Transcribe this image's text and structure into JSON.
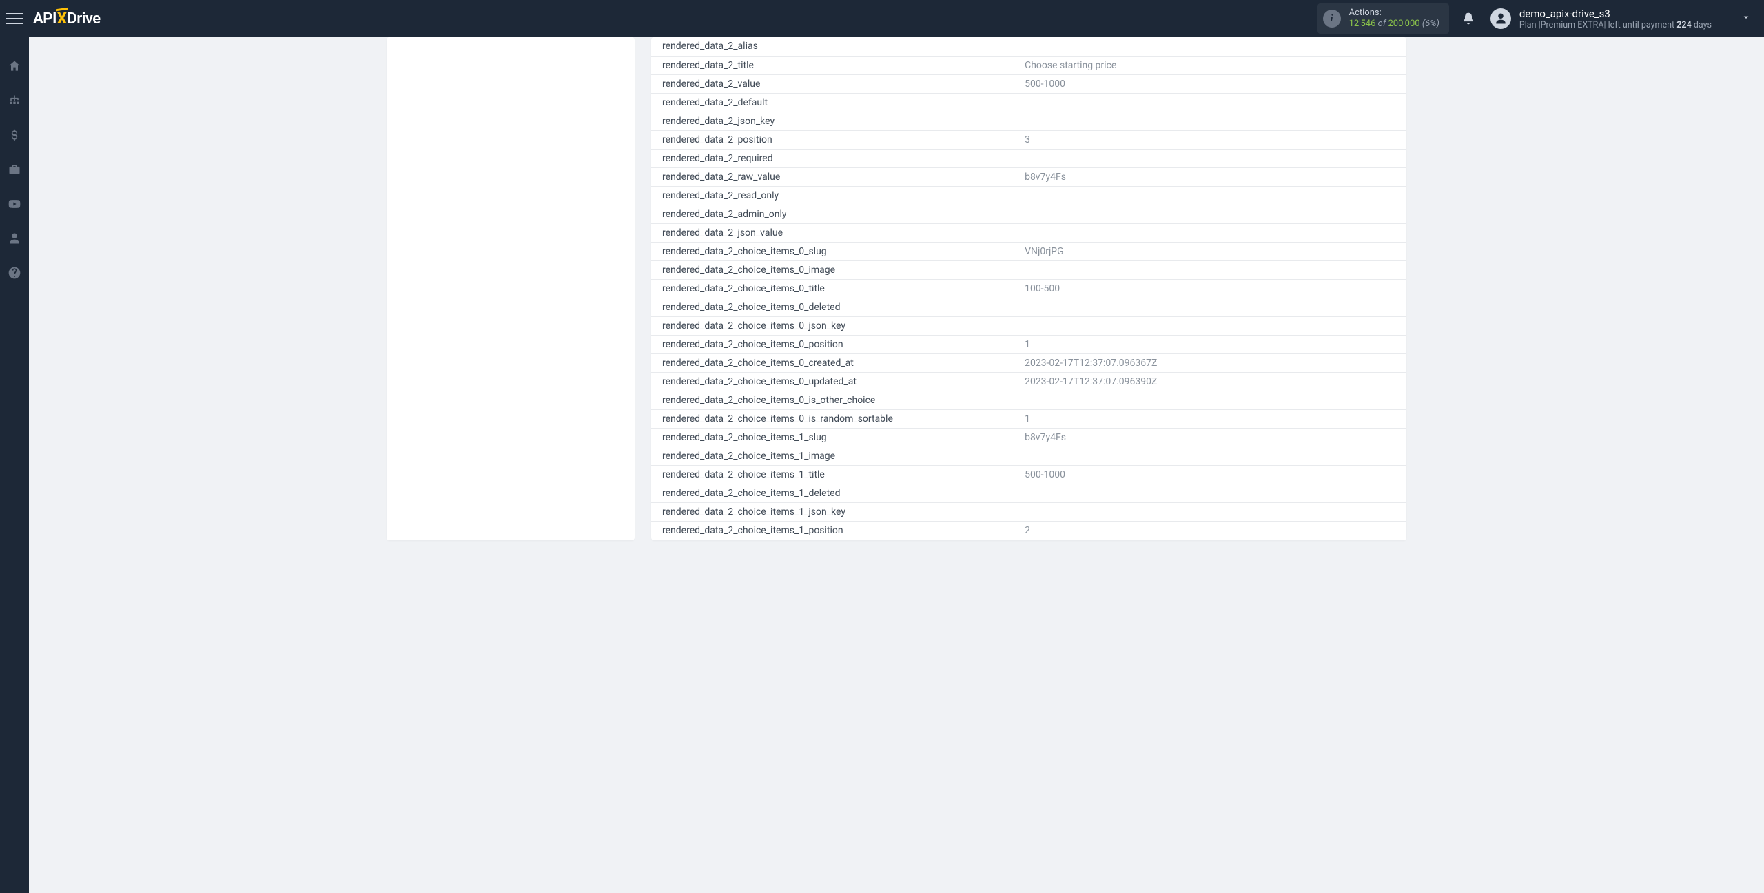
{
  "logo": {
    "part1": "API",
    "part2": "X",
    "part3": "Drive"
  },
  "actions": {
    "label": "Actions:",
    "used": "12'546",
    "of": "of",
    "limit": "200'000",
    "percent": "(6%)"
  },
  "user": {
    "name": "demo_apix-drive_s3",
    "plan_prefix": "Plan |",
    "plan_name": "Premium EXTRA",
    "plan_sep": "|",
    "plan_left": " left until payment ",
    "plan_days_num": "224",
    "plan_days_word": " days"
  },
  "rows": [
    {
      "key": "rendered_data_2_alias",
      "val": ""
    },
    {
      "key": "rendered_data_2_title",
      "val": "Choose starting price"
    },
    {
      "key": "rendered_data_2_value",
      "val": "500-1000"
    },
    {
      "key": "rendered_data_2_default",
      "val": ""
    },
    {
      "key": "rendered_data_2_json_key",
      "val": ""
    },
    {
      "key": "rendered_data_2_position",
      "val": "3"
    },
    {
      "key": "rendered_data_2_required",
      "val": ""
    },
    {
      "key": "rendered_data_2_raw_value",
      "val": "b8v7y4Fs"
    },
    {
      "key": "rendered_data_2_read_only",
      "val": ""
    },
    {
      "key": "rendered_data_2_admin_only",
      "val": ""
    },
    {
      "key": "rendered_data_2_json_value",
      "val": ""
    },
    {
      "key": "rendered_data_2_choice_items_0_slug",
      "val": "VNj0rjPG"
    },
    {
      "key": "rendered_data_2_choice_items_0_image",
      "val": ""
    },
    {
      "key": "rendered_data_2_choice_items_0_title",
      "val": "100-500"
    },
    {
      "key": "rendered_data_2_choice_items_0_deleted",
      "val": ""
    },
    {
      "key": "rendered_data_2_choice_items_0_json_key",
      "val": ""
    },
    {
      "key": "rendered_data_2_choice_items_0_position",
      "val": "1"
    },
    {
      "key": "rendered_data_2_choice_items_0_created_at",
      "val": "2023-02-17T12:37:07.096367Z"
    },
    {
      "key": "rendered_data_2_choice_items_0_updated_at",
      "val": "2023-02-17T12:37:07.096390Z"
    },
    {
      "key": "rendered_data_2_choice_items_0_is_other_choice",
      "val": ""
    },
    {
      "key": "rendered_data_2_choice_items_0_is_random_sortable",
      "val": "1"
    },
    {
      "key": "rendered_data_2_choice_items_1_slug",
      "val": "b8v7y4Fs"
    },
    {
      "key": "rendered_data_2_choice_items_1_image",
      "val": ""
    },
    {
      "key": "rendered_data_2_choice_items_1_title",
      "val": "500-1000"
    },
    {
      "key": "rendered_data_2_choice_items_1_deleted",
      "val": ""
    },
    {
      "key": "rendered_data_2_choice_items_1_json_key",
      "val": ""
    },
    {
      "key": "rendered_data_2_choice_items_1_position",
      "val": "2"
    }
  ]
}
